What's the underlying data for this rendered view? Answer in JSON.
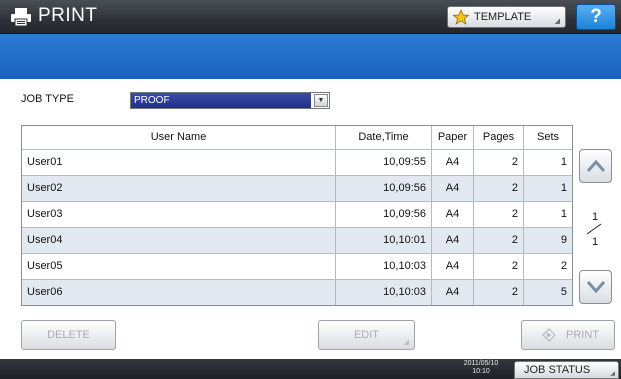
{
  "header": {
    "title": "PRINT",
    "template_label": "TEMPLATE",
    "help_label": "?"
  },
  "job_type": {
    "label": "JOB TYPE",
    "selected": "PROOF"
  },
  "table": {
    "columns": [
      "User Name",
      "Date,Time",
      "Paper",
      "Pages",
      "Sets"
    ],
    "rows": [
      {
        "user": "User01",
        "datetime": "10,09:55",
        "paper": "A4",
        "pages": "2",
        "sets": "1"
      },
      {
        "user": "User02",
        "datetime": "10,09:56",
        "paper": "A4",
        "pages": "2",
        "sets": "1"
      },
      {
        "user": "User03",
        "datetime": "10,09:56",
        "paper": "A4",
        "pages": "2",
        "sets": "1"
      },
      {
        "user": "User04",
        "datetime": "10,10:01",
        "paper": "A4",
        "pages": "2",
        "sets": "9"
      },
      {
        "user": "User05",
        "datetime": "10,10:03",
        "paper": "A4",
        "pages": "2",
        "sets": "2"
      },
      {
        "user": "User06",
        "datetime": "10,10:03",
        "paper": "A4",
        "pages": "2",
        "sets": "5"
      }
    ]
  },
  "pagination": {
    "current": "1",
    "total": "1"
  },
  "actions": {
    "delete_label": "DELETE",
    "edit_label": "EDIT",
    "print_label": "PRINT"
  },
  "status_bar": {
    "date": "2011/05/10",
    "time": "10:10",
    "job_status_label": "JOB STATUS"
  },
  "icons": {
    "header": "printer-icon",
    "template": "star-icon",
    "scroll_up": "chevron-up-icon",
    "scroll_down": "chevron-down-icon",
    "print_action": "diamond-arrow-icon"
  },
  "colors": {
    "title_bar": "#2e3238",
    "blue_band": "#1a61bd",
    "alt_row": "#e3e9f1",
    "help_button": "#1e82d6",
    "selected_option": "#1f2f88"
  }
}
